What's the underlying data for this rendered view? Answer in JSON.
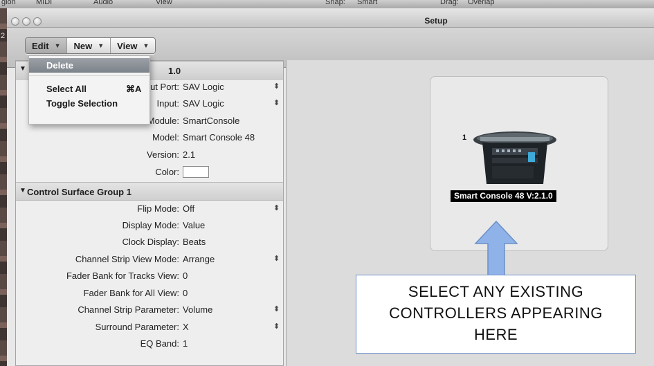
{
  "host": {
    "menu_fragments": [
      "gion",
      "MIDI",
      "Audio",
      "View",
      "Snap:",
      "Smart",
      "Drag:",
      "Overlap"
    ],
    "side_number": "2"
  },
  "window": {
    "title": "Setup"
  },
  "toolbar": {
    "buttons": [
      {
        "label": "Edit"
      },
      {
        "label": "New"
      },
      {
        "label": "View"
      }
    ]
  },
  "edit_menu": {
    "items": [
      {
        "label": "Delete",
        "shortcut": ""
      },
      {
        "label": "Select All",
        "shortcut": "⌘A"
      },
      {
        "label": "Toggle Selection",
        "shortcut": ""
      }
    ]
  },
  "inspector": {
    "device_header_suffix": "1.0",
    "device_rows": [
      {
        "label": "ut Port:",
        "value": "SAV Logic",
        "stepper": "⬍"
      },
      {
        "label": "Input:",
        "value": "SAV Logic",
        "stepper": "⬍"
      },
      {
        "label": "Module:",
        "value": "SmartConsole"
      },
      {
        "label": "Model:",
        "value": "Smart Console 48"
      },
      {
        "label": "Version:",
        "value": "2.1"
      },
      {
        "label": "Color:",
        "value": ""
      }
    ],
    "group_header": "Control Surface Group 1",
    "group_rows": [
      {
        "label": "Flip Mode:",
        "value": "Off",
        "stepper": "⬍"
      },
      {
        "label": "Display Mode:",
        "value": "Value"
      },
      {
        "label": "Clock Display:",
        "value": "Beats"
      },
      {
        "label": "Channel Strip View Mode:",
        "value": "Arrange",
        "stepper": "⬍"
      },
      {
        "label": "Fader Bank for Tracks View:",
        "value": "0"
      },
      {
        "label": "Fader Bank for All View:",
        "value": "0"
      },
      {
        "label": "Channel Strip Parameter:",
        "value": "Volume",
        "stepper": "⬍"
      },
      {
        "label": "Surround Parameter:",
        "value": "X",
        "stepper": "⬍"
      },
      {
        "label": "EQ Band:",
        "value": "1"
      }
    ]
  },
  "canvas": {
    "device_number": "1",
    "device_label": "Smart Console 48 V:2.1.0"
  },
  "callout": {
    "lines": [
      "SELECT ANY EXISTING",
      "CONTROLLERS APPEARING",
      "HERE"
    ],
    "border_color": "#6b8fc9",
    "arrow_color": "#8fb3e8"
  }
}
